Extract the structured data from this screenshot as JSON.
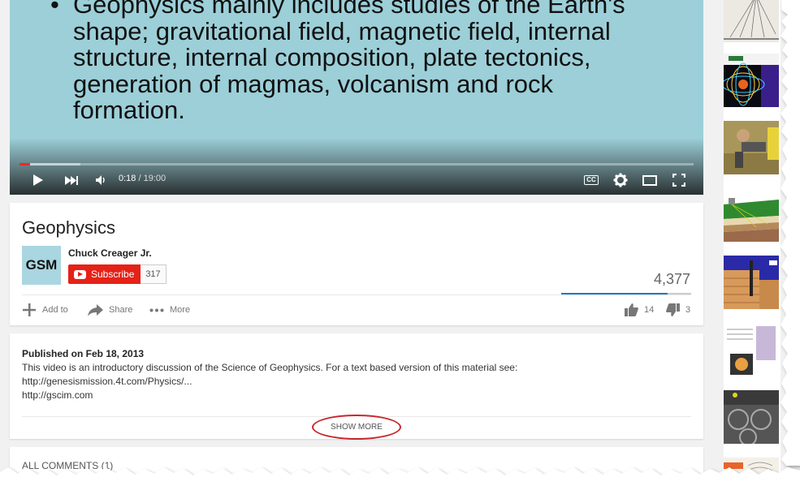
{
  "player": {
    "slide_lines": [
      "Geophysics mainly includes studies of the Earth's",
      "shape; gravitational field, magnetic field, internal",
      "structure, internal composition, plate tectonics,",
      "generation of magmas, volcanism and rock",
      "formation."
    ],
    "bullet": "•",
    "time_current": "0:18",
    "time_separator": " / ",
    "time_total": "19:00",
    "progress_fraction": 0.016,
    "cc_label": "CC"
  },
  "video": {
    "title": "Geophysics",
    "channel": {
      "avatar_text": "GSM",
      "name": "Chuck Creager Jr.",
      "subscribe_label": "Subscribe",
      "subscriber_count": "317"
    },
    "views": "4,377",
    "likes_fraction": 0.82,
    "actions": {
      "add_to": "Add to",
      "share": "Share",
      "more": "More",
      "likes": "14",
      "dislikes": "3"
    }
  },
  "description": {
    "published": "Published on Feb 18, 2013",
    "lines": [
      "This video is an introductory discussion of the Science of Geophysics. For a text based version of this material see:",
      "http://genesismission.4t.com/Physics/...",
      "http://gscim.com"
    ],
    "show_more": "SHOW MORE"
  },
  "comments": {
    "title": "ALL COMMENTS (1)"
  },
  "colors": {
    "brand_red": "#e62117",
    "player_bg": "#9ccfd8",
    "link_blue": "#167ac6",
    "annotation_red": "#c8272d"
  },
  "sidebar": {
    "thumbnails": [
      {
        "name": "thumb-ray-diagram"
      },
      {
        "name": "thumb-magnetic-field"
      },
      {
        "name": "thumb-field-equipment"
      },
      {
        "name": "thumb-seismic-layers"
      },
      {
        "name": "thumb-fault-block"
      },
      {
        "name": "thumb-chart-slide"
      },
      {
        "name": "thumb-core-samples"
      },
      {
        "name": "thumb-isopach"
      }
    ]
  }
}
